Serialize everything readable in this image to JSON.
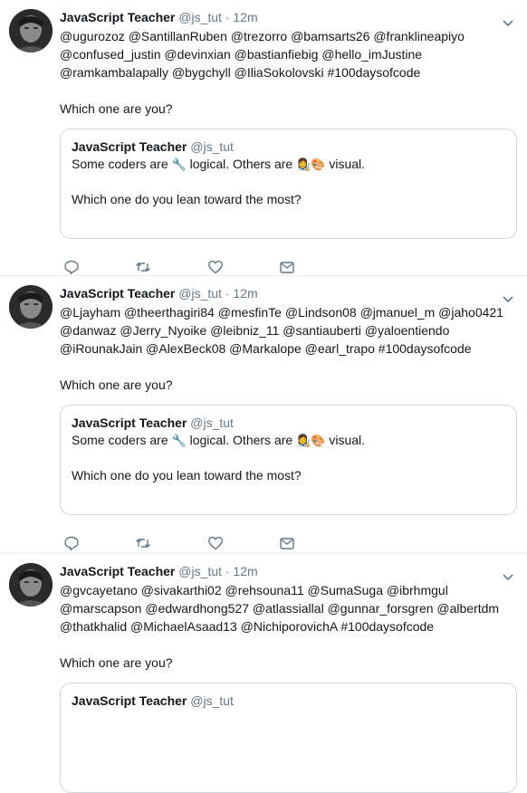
{
  "tweets": [
    {
      "author_name": "JavaScript Teacher",
      "handle": "@js_tut",
      "separator": "·",
      "time": "12m",
      "mentions": "@ugurozoz @SantillanRuben @trezorro @bamsarts26 @franklineapiyo @confused_justin @devinxian @bastianfiebig @hello_imJustine @ramkambalapally @bygchyll @IliaSokolovski #100daysofcode",
      "question": "Which one are you?",
      "quote": {
        "author_name": "JavaScript Teacher",
        "handle": "@js_tut",
        "line1_a": "Some coders are ",
        "wrench": "🔧",
        "line1_b": " logical. Others are ",
        "artist": "👩‍🎨🎨",
        "line1_c": " visual.",
        "line2": "Which one do you lean toward the most?"
      }
    },
    {
      "author_name": "JavaScript Teacher",
      "handle": "@js_tut",
      "separator": "·",
      "time": "12m",
      "mentions": "@Ljayham @theerthagiri84 @mesfinTe @Lindson08 @jmanuel_m @jaho0421 @danwaz @Jerry_Nyoike @leibniz_11 @santiauberti @yaloentiendo @iRounakJain @AlexBeck08 @Markalope @earl_trapo #100daysofcode",
      "question": "Which one are you?",
      "quote": {
        "author_name": "JavaScript Teacher",
        "handle": "@js_tut",
        "line1_a": "Some coders are ",
        "wrench": "🔧",
        "line1_b": " logical. Others are ",
        "artist": "👩‍🎨🎨",
        "line1_c": " visual.",
        "line2": "Which one do you lean toward the most?"
      }
    },
    {
      "author_name": "JavaScript Teacher",
      "handle": "@js_tut",
      "separator": "·",
      "time": "12m",
      "mentions": "@gvcayetano @sivakarthi02 @rehsouna11 @SumaSuga @ibrhmgul @marscapson @edwardhong527 @atlassiallal @gunnar_forsgren @albertdm @thatkhalid @MichaelAsaad13 @NichiporovichA #100daysofcode",
      "question": "Which one are you?",
      "quote": {
        "author_name": "JavaScript Teacher",
        "handle": "@js_tut"
      }
    }
  ],
  "icons": {
    "reply": "reply-icon",
    "retweet": "retweet-icon",
    "like": "heart-icon",
    "dm": "envelope-icon",
    "caret": "chevron-down-icon"
  },
  "colors": {
    "icon_gray": "#657786",
    "border": "#e6ecf0",
    "quote_border": "#ccd6dd"
  }
}
